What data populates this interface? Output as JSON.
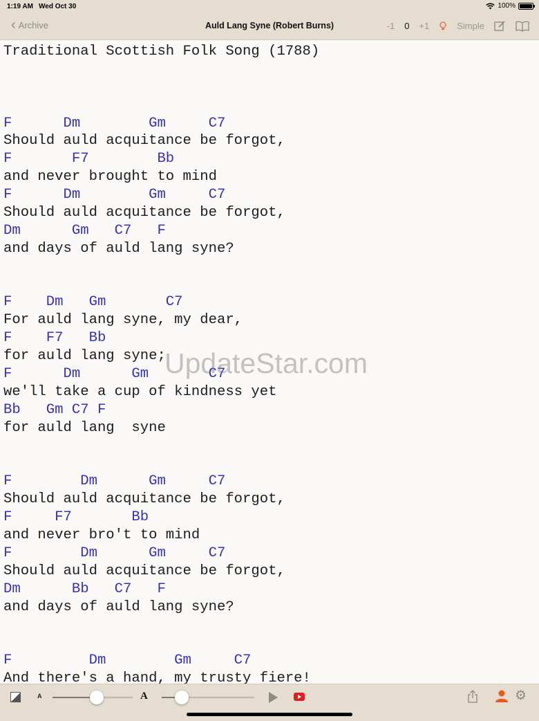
{
  "status_bar": {
    "time": "1:19 AM",
    "date": "Wed Oct 30",
    "battery": "100%",
    "battery_level": 1.0
  },
  "nav": {
    "back_label": "Archive",
    "title": "Auld Lang Syne (Robert Burns)",
    "transpose_down": "-1",
    "transpose_value": "0",
    "transpose_up": "+1",
    "mode_label": "Simple",
    "icons": [
      "lightbulb-icon",
      "edit-icon",
      "book-icon"
    ]
  },
  "sheet": {
    "lines": [
      {
        "text": "Traditional Scottish Folk Song (1788)",
        "chord": false
      },
      {
        "text": "",
        "chord": false
      },
      {
        "text": "",
        "chord": false
      },
      {
        "text": "",
        "chord": false
      },
      {
        "text": "F      Dm        Gm     C7",
        "chord": true
      },
      {
        "text": "Should auld acquitance be forgot,",
        "chord": false
      },
      {
        "text": "F       F7        Bb",
        "chord": true
      },
      {
        "text": "and never brought to mind",
        "chord": false
      },
      {
        "text": "F      Dm        Gm     C7",
        "chord": true
      },
      {
        "text": "Should auld acquitance be forgot,",
        "chord": false
      },
      {
        "text": "Dm      Gm   C7   F",
        "chord": true
      },
      {
        "text": "and days of auld lang syne?",
        "chord": false
      },
      {
        "text": "",
        "chord": false
      },
      {
        "text": "",
        "chord": false
      },
      {
        "text": "F    Dm   Gm       C7",
        "chord": true
      },
      {
        "text": "For auld lang syne, my dear,",
        "chord": false
      },
      {
        "text": "F    F7   Bb",
        "chord": true
      },
      {
        "text": "for auld lang syne;",
        "chord": false
      },
      {
        "text": "F      Dm      Gm       C7",
        "chord": true
      },
      {
        "text": "we'll take a cup of kindness yet",
        "chord": false
      },
      {
        "text": "Bb   Gm C7 F",
        "chord": true
      },
      {
        "text": "for auld lang  syne",
        "chord": false
      },
      {
        "text": "",
        "chord": false
      },
      {
        "text": "",
        "chord": false
      },
      {
        "text": "F        Dm      Gm     C7",
        "chord": true
      },
      {
        "text": "Should auld acquitance be forgot,",
        "chord": false
      },
      {
        "text": "F     F7       Bb",
        "chord": true
      },
      {
        "text": "and never bro't to mind",
        "chord": false
      },
      {
        "text": "F        Dm      Gm     C7",
        "chord": true
      },
      {
        "text": "Should auld acquitance be forgot,",
        "chord": false
      },
      {
        "text": "Dm      Bb   C7   F",
        "chord": true
      },
      {
        "text": "and days of auld lang syne?",
        "chord": false
      },
      {
        "text": "",
        "chord": false
      },
      {
        "text": "",
        "chord": false
      },
      {
        "text": "F         Dm        Gm     C7",
        "chord": true
      },
      {
        "text": "And there's a hand, my trusty fiere!",
        "chord": false
      }
    ]
  },
  "watermark": "UpdateStar.com",
  "toolbar": {
    "font_small_label": "A",
    "font_large_label": "A",
    "slider1_value": 0.55,
    "slider2_value": 0.22,
    "icons": [
      "contrast-icon",
      "play-icon",
      "youtube-icon",
      "share-icon",
      "person-icon",
      "gear-icon"
    ]
  },
  "colors": {
    "chord": "#3532b8",
    "lyric": "#1c1c1c",
    "bar": "#e4ddd0",
    "accent": "#e06a4a"
  }
}
